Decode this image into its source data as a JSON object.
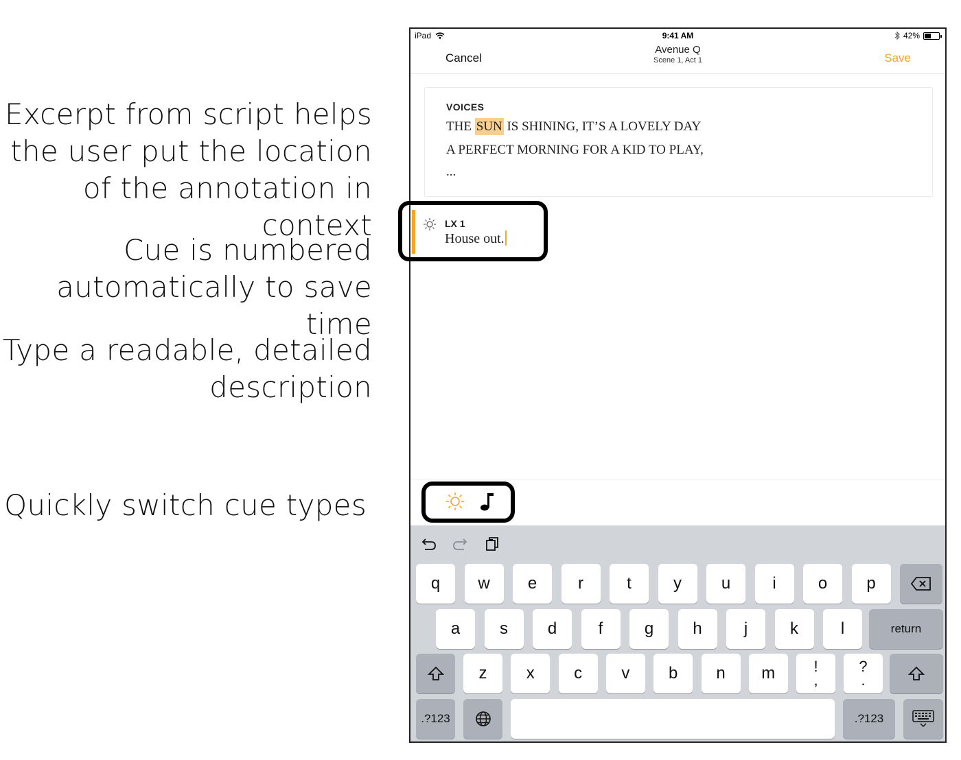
{
  "annotations": {
    "excerpt": "Excerpt from script helps the user put the location of the annotation in context",
    "numbered": "Cue is numbered automatically to save time",
    "description": "Type a readable, detailed description",
    "switch": "Quickly switch cue types"
  },
  "statusbar": {
    "device": "iPad",
    "time": "9:41 AM",
    "battery": "42%",
    "battery_level": 0.42
  },
  "navbar": {
    "cancel": "Cancel",
    "title": "Avenue Q",
    "subtitle": "Scene 1, Act 1",
    "save": "Save"
  },
  "excerpt": {
    "speaker": "VOICES",
    "line1_before": "THE ",
    "line1_highlight": "SUN",
    "line1_after": " IS SHINING, IT’S A LOVELY DAY",
    "line2": "A PERFECT MORNING FOR A KID TO PLAY,",
    "line3": "..."
  },
  "cue": {
    "number": "LX 1",
    "description": "House out."
  },
  "cue_types": [
    {
      "name": "lighting",
      "icon": "sun-icon",
      "selected": true
    },
    {
      "name": "sound",
      "icon": "music-note-icon",
      "selected": false
    }
  ],
  "keyboard": {
    "row1": [
      "q",
      "w",
      "e",
      "r",
      "t",
      "y",
      "u",
      "i",
      "o",
      "p"
    ],
    "row2": [
      "a",
      "s",
      "d",
      "f",
      "g",
      "h",
      "j",
      "k",
      "l"
    ],
    "return": "return",
    "row3": [
      "z",
      "x",
      "c",
      "v",
      "b",
      "n",
      "m"
    ],
    "punct1_top": "!",
    "punct1_bottom": ",",
    "punct2_top": "?",
    "punct2_bottom": ".",
    "numbers": ".?123"
  },
  "colors": {
    "accent": "#f5a623",
    "highlight": "#f8cf8f",
    "keyboard_bg": "#d1d4d9"
  }
}
